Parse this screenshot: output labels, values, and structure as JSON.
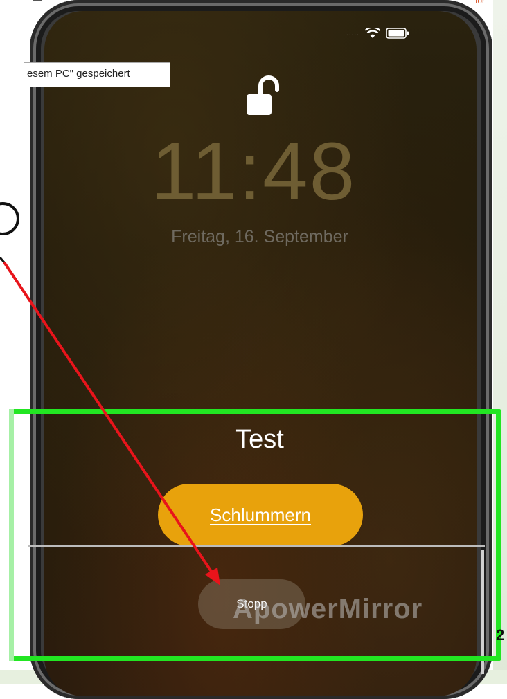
{
  "desktop": {
    "top_right_fragment": "for",
    "edge_fragment": "2",
    "tooltip_text": "esem PC\" gespeichert"
  },
  "phone": {
    "status": {
      "signal": "....."
    },
    "lockscreen": {
      "time": "11:48",
      "date": "Freitag, 16. September"
    },
    "alarm": {
      "title": "Test",
      "snooze_label": "Schlummern",
      "stop_label": "Stopp"
    }
  },
  "mirror_app": {
    "watermark": "ApowerMirror"
  },
  "annotations": {
    "highlight_color": "#22e622",
    "arrow_color": "#e8141b"
  },
  "colors": {
    "snooze_button": "#e8a20c",
    "clock_text": "#6e5d33"
  }
}
